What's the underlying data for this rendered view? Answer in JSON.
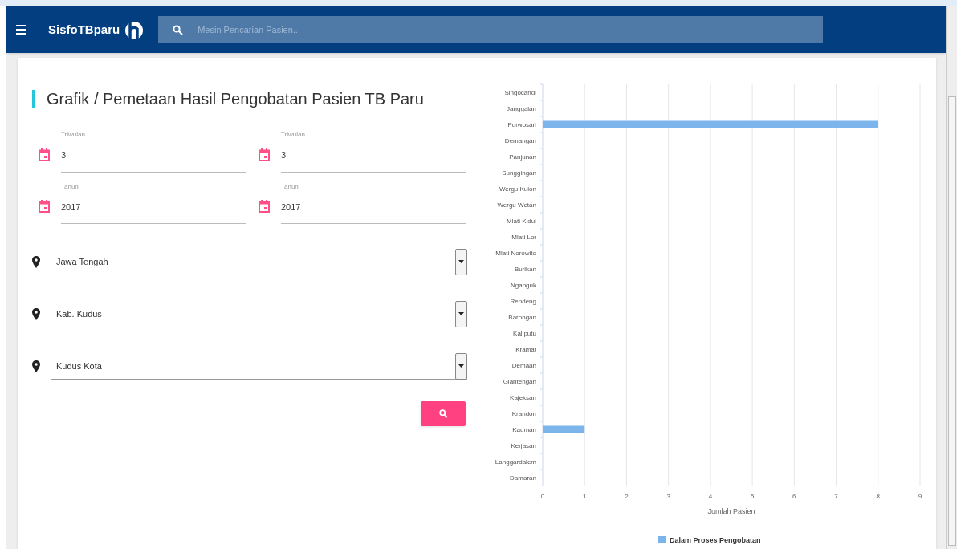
{
  "navbar": {
    "brand": "SisfoTBparu",
    "search": {
      "placeholder": "Mesin Pencarian Pasien..."
    }
  },
  "title": "Grafik / Pemetaan Hasil Pengobatan Pasien TB Paru",
  "date_fields": [
    {
      "label": "Triwulan",
      "value": "3"
    },
    {
      "label": "Triwulan",
      "value": "3"
    },
    {
      "label": "Tahun",
      "value": "2017"
    },
    {
      "label": "Tahun",
      "value": "2017"
    }
  ],
  "selects": [
    {
      "value": "Jawa Tengah"
    },
    {
      "value": "Kab. Kudus"
    },
    {
      "value": "Kudus Kota"
    }
  ],
  "chart_data": {
    "type": "bar",
    "orientation": "horizontal",
    "xlabel": "Jumlah Pasien",
    "categories": [
      "Singocandi",
      "Janggalan",
      "Purwosari",
      "Demangan",
      "Panjunan",
      "Sunggingan",
      "Wergu Kulon",
      "Wergu Wetan",
      "Mlati Kidul",
      "Mlati Lor",
      "Mlati Norowito",
      "Burikan",
      "Nganguk",
      "Rendeng",
      "Barongan",
      "Kaliputu",
      "Kramat",
      "Demaan",
      "Glantengan",
      "Kajeksan",
      "Krandon",
      "Kauman",
      "Kerjasan",
      "Langgardalem",
      "Damaran"
    ],
    "series": [
      {
        "name": "Dalam Proses Pengobatan",
        "color": "#7cb5ec",
        "values": [
          0,
          0,
          8,
          0,
          0,
          0,
          0,
          0,
          0,
          0,
          0,
          0,
          0,
          0,
          0,
          0,
          0,
          0,
          0,
          0,
          0,
          1,
          0,
          0,
          0
        ]
      }
    ],
    "grid": true,
    "xlim": [
      0,
      9
    ],
    "xticks": [
      0,
      1,
      2,
      3,
      4,
      5,
      6,
      7,
      8,
      9
    ]
  }
}
